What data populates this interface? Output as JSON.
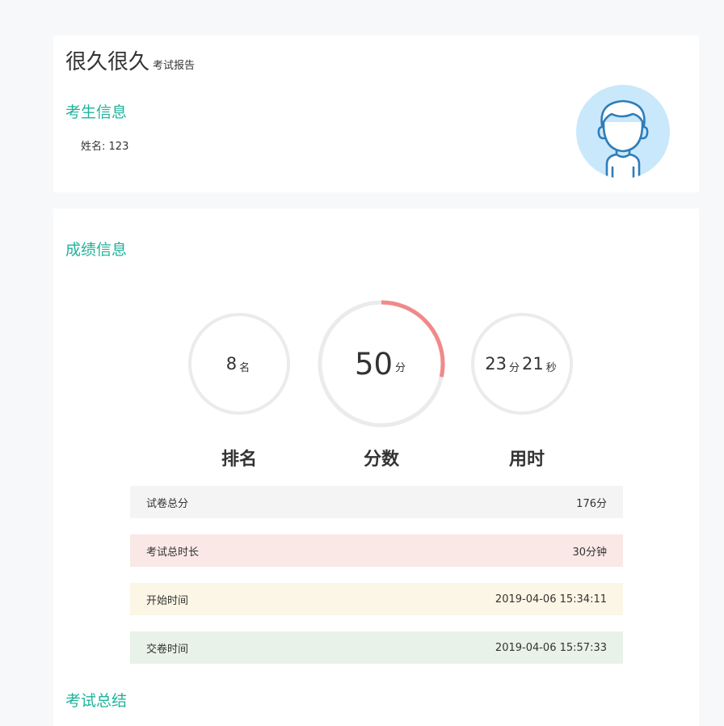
{
  "header": {
    "title": "很久很久",
    "subtitle": "考试报告"
  },
  "student_section": {
    "title": "考生信息",
    "name_label": "姓名:",
    "name_value": "123",
    "avatar_icon": "user-avatar-icon"
  },
  "score_section": {
    "title": "成绩信息",
    "gauges": [
      {
        "name": "rank",
        "value": "8",
        "unit": "名",
        "label": "排名",
        "progress": 0
      },
      {
        "name": "score",
        "value": "50",
        "unit": "分",
        "label": "分数",
        "progress": 0.284
      },
      {
        "name": "time",
        "minutes": "23",
        "minutes_unit": "分",
        "seconds": "21",
        "seconds_unit": "秒",
        "label": "用时",
        "progress": 0
      }
    ],
    "rows": [
      {
        "label": "试卷总分",
        "value": "176分",
        "bg": "#f4f4f4"
      },
      {
        "label": "考试总时长",
        "value": "30分钟",
        "bg": "#fae8e6"
      },
      {
        "label": "开始时间",
        "value": "2019-04-06 15:34:11",
        "bg": "#fbf6e5"
      },
      {
        "label": "交卷时间",
        "value": "2019-04-06 15:57:33",
        "bg": "#e8f2e8"
      }
    ]
  },
  "summary_section": {
    "title": "考试总结"
  },
  "colors": {
    "accent": "#1fb39a",
    "gauge_track": "#ebebeb",
    "gauge_progress": "#f0898a",
    "avatar_bg": "#c9e8fb",
    "avatar_stroke": "#2f7db8"
  }
}
